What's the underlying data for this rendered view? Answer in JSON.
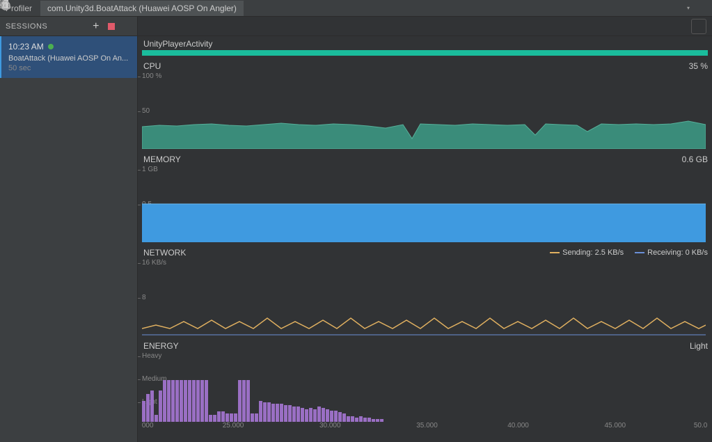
{
  "titlebar": {
    "app_label": "Profiler",
    "tab_label": "com.Unity3d.BoatAttack (Huawei AOSP On Angler)"
  },
  "sidebar": {
    "header": "SESSIONS",
    "session": {
      "time": "10:23 AM",
      "name": "BoatAttack (Huawei AOSP On An...",
      "duration": "50 sec"
    }
  },
  "activity": {
    "label": "UnityPlayerActivity"
  },
  "charts": {
    "cpu": {
      "title": "CPU",
      "value": "35 %",
      "axis_top": "100 %",
      "axis_mid": "50"
    },
    "memory": {
      "title": "MEMORY",
      "value": "0.6 GB",
      "axis_top": "1 GB",
      "axis_mid": "0.5"
    },
    "network": {
      "title": "NETWORK",
      "sending_label": "Sending: 2.5 KB/s",
      "receiving_label": "Receiving: 0 KB/s",
      "axis_top": "16 KB/s",
      "axis_mid": "8"
    },
    "energy": {
      "title": "ENERGY",
      "value": "Light",
      "axis_heavy": "Heavy",
      "axis_medium": "Medium",
      "axis_light": "Light"
    }
  },
  "time_axis": [
    "000",
    "25.000",
    "30.000",
    "35.000",
    "40.000",
    "45.000",
    "50.0"
  ],
  "colors": {
    "cpu_fill": "#3a8c7a",
    "memory_fill": "#3f9ae0",
    "network_send": "#e0b060",
    "network_recv": "#6a8fd8",
    "energy_bar": "#9a6fc4",
    "activity": "#1abc9c"
  },
  "chart_data": {
    "type": "line",
    "x_range_seconds": [
      20,
      50
    ],
    "cpu": {
      "unit": "%",
      "ylim": [
        0,
        100
      ],
      "approx_values": [
        32,
        34,
        33,
        35,
        36,
        34,
        33,
        35,
        37,
        35,
        34,
        36,
        35,
        33,
        30,
        20,
        36,
        35,
        34,
        36,
        35,
        34,
        35,
        25,
        36,
        35,
        34,
        28,
        36,
        35,
        36,
        35
      ]
    },
    "memory": {
      "unit": "GB",
      "ylim": [
        0,
        1
      ],
      "approx_values": [
        0.48,
        0.48,
        0.48,
        0.48,
        0.48,
        0.48,
        0.48,
        0.48,
        0.48,
        0.48,
        0.48,
        0.48,
        0.48,
        0.48,
        0.48,
        0.48,
        0.48,
        0.48,
        0.48,
        0.48
      ]
    },
    "network_sending": {
      "unit": "KB/s",
      "ylim": [
        0,
        16
      ],
      "approx_values": [
        2,
        3,
        2,
        3,
        2,
        3,
        2,
        3,
        2,
        4,
        2,
        3,
        2,
        3,
        2,
        4,
        2,
        3,
        2,
        3,
        2,
        4,
        2,
        3,
        2,
        3,
        2,
        4,
        2,
        3,
        2,
        3
      ]
    },
    "network_receiving": {
      "unit": "KB/s",
      "ylim": [
        0,
        16
      ],
      "approx_values": [
        0,
        0,
        0,
        0,
        0,
        0,
        0,
        0,
        0,
        0,
        0,
        0,
        0,
        0,
        0,
        0,
        0,
        0,
        0,
        0
      ]
    },
    "energy": {
      "levels": [
        "Light",
        "Medium",
        "Heavy"
      ],
      "approx_level_index": [
        1,
        1,
        0,
        1,
        2,
        2,
        2,
        2,
        2,
        2,
        2,
        2,
        2,
        2,
        0,
        0,
        2,
        2,
        0,
        0,
        1,
        1,
        1,
        1,
        1,
        1,
        1,
        1,
        1,
        1,
        0,
        0,
        0,
        0,
        0,
        0,
        0,
        0,
        0,
        0,
        0,
        0,
        0,
        0,
        0,
        0,
        0,
        0,
        0,
        0,
        0,
        0,
        0,
        0
      ]
    }
  }
}
